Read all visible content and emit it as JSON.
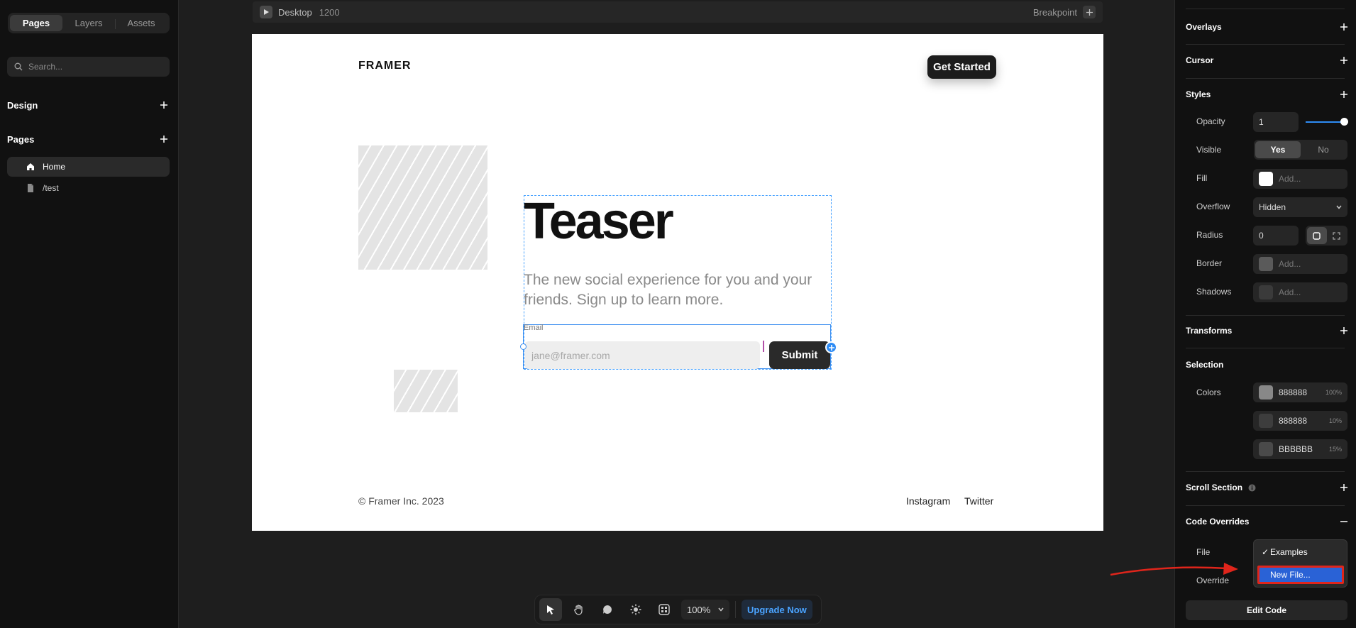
{
  "left_panel": {
    "tabs": [
      "Pages",
      "Layers",
      "Assets"
    ],
    "search_placeholder": "Search...",
    "design_label": "Design",
    "pages_label": "Pages",
    "pages": [
      "Home",
      "/test"
    ]
  },
  "canvas": {
    "breakpoint_name": "Desktop",
    "breakpoint_width": "1200",
    "breakpoint_label": "Breakpoint",
    "site": {
      "logo": "FRAMER",
      "cta": "Get Started",
      "heading": "Teaser",
      "subheading": "The new social experience for you and your friends. Sign up to learn more.",
      "email_label": "Email",
      "email_placeholder": "jane@framer.com",
      "submit": "Submit",
      "copyright": "© Framer Inc. 2023",
      "footer_links": [
        "Instagram",
        "Twitter"
      ]
    }
  },
  "toolbar": {
    "zoom": "100%",
    "upgrade": "Upgrade Now"
  },
  "right_panel": {
    "overlays": "Overlays",
    "cursor": "Cursor",
    "styles": "Styles",
    "opacity_label": "Opacity",
    "opacity_value": "1",
    "opacity_level": 1.0,
    "visible_label": "Visible",
    "visible_options": [
      "Yes",
      "No"
    ],
    "fill_label": "Fill",
    "fill_placeholder": "Add...",
    "overflow_label": "Overflow",
    "overflow_value": "Hidden",
    "radius_label": "Radius",
    "radius_value": "0",
    "border_label": "Border",
    "border_placeholder": "Add...",
    "shadows_label": "Shadows",
    "shadows_placeholder": "Add...",
    "transforms": "Transforms",
    "selection": "Selection",
    "colors_label": "Colors",
    "colors": [
      {
        "hex": "888888",
        "pct": "100%",
        "swatch": "#888888"
      },
      {
        "hex": "888888",
        "pct": "10%",
        "swatch": "#3d3d3d"
      },
      {
        "hex": "BBBBBB",
        "pct": "15%",
        "swatch": "#4a4a4a"
      }
    ],
    "scroll_section": "Scroll Section",
    "code_overrides": "Code Overrides",
    "file_label": "File",
    "override_label": "Override",
    "file_options": [
      "Examples",
      "New File..."
    ],
    "edit_code": "Edit Code"
  },
  "colors": {
    "accent": "#2e8cf5",
    "highlight": "#2a62d6",
    "annotation_red": "#e0251b"
  }
}
